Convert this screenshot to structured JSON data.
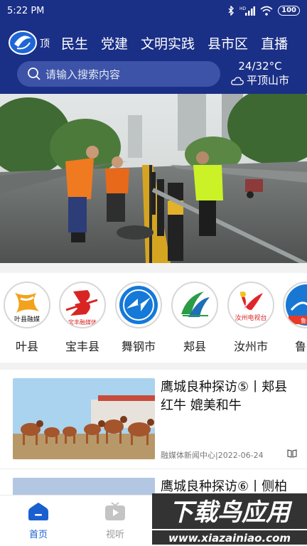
{
  "status": {
    "time": "5:22 PM",
    "battery": "100",
    "network": "HD"
  },
  "nav": {
    "logo_text": "顶",
    "tabs": [
      "民生",
      "党建",
      "文明实践",
      "县市区",
      "直播"
    ]
  },
  "search": {
    "placeholder": "请输入搜索内容"
  },
  "weather": {
    "temp": "24/32°C",
    "city": "平顶山市"
  },
  "channels": [
    {
      "label": "叶县",
      "logo_text": "叶县融媒"
    },
    {
      "label": "宝丰县",
      "logo_text": "宝丰融媒体"
    },
    {
      "label": "舞钢市",
      "logo_text": ""
    },
    {
      "label": "郏县",
      "logo_text": ""
    },
    {
      "label": "汝州市",
      "logo_text": "汝州电视台"
    },
    {
      "label": "鲁山",
      "logo_text": "鲁山"
    }
  ],
  "news": [
    {
      "title": "鹰城良种探访⑤丨郏县红牛 媲美和牛",
      "source": "融媒体新闻中心",
      "date": "2022-06-24"
    },
    {
      "title": "鹰城良种探访⑥丨侧柏",
      "source": "",
      "date": ""
    }
  ],
  "bottom_nav": {
    "home": "首页",
    "video": "视听"
  },
  "watermark": {
    "title": "下载鸟应用",
    "url": "www.xiazainiao.com"
  },
  "colors": {
    "header": "#1a2f86",
    "accent": "#1a5fd0"
  }
}
